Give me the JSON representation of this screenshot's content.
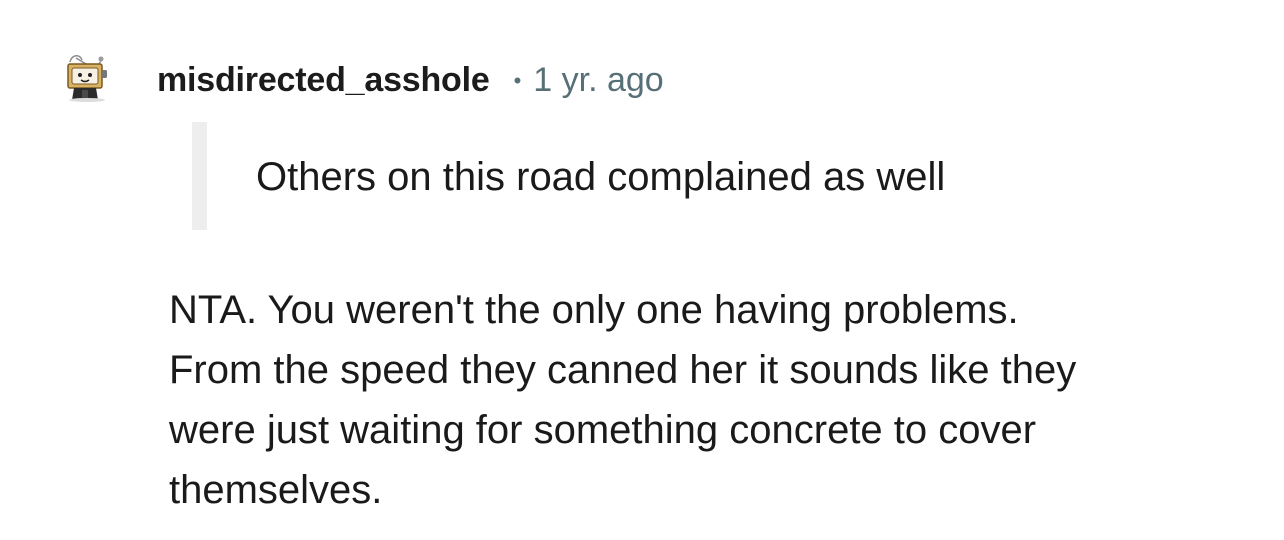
{
  "comment": {
    "username": "misdirected_asshole",
    "separator": "•",
    "timestamp": "1 yr. ago",
    "quote": "Others on this road complained as well",
    "body_lines": [
      "NTA. You weren't the only one having problems.",
      "From the speed they canned her it sounds like they",
      "were just waiting for something concrete to cover",
      "themselves."
    ],
    "avatar_icon": "snoo-avatar-icon"
  },
  "colors": {
    "username": "#1c1c1c",
    "meta": "#576f76",
    "text": "#1a1a1b",
    "quote_bar": "#eeeeee"
  }
}
